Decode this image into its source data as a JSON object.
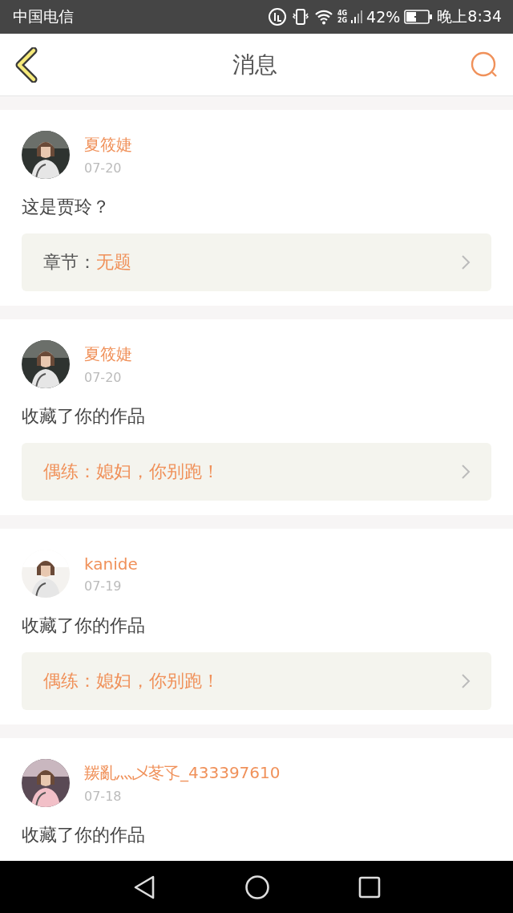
{
  "status_bar": {
    "carrier": "中国电信",
    "network": [
      "4G",
      "2G"
    ],
    "battery": "42%",
    "time": "晚上8:34"
  },
  "header": {
    "title": "消息"
  },
  "messages": [
    {
      "name": "夏筱婕",
      "date": "07-20",
      "text": "这是贾玲？",
      "ref": {
        "label": "章节：",
        "title": "无题"
      }
    },
    {
      "name": "夏筱婕",
      "date": "07-20",
      "text": "收藏了你的作品",
      "ref": {
        "title": "偶练：媳妇，你别跑！"
      }
    },
    {
      "name": "kanide",
      "date": "07-19",
      "text": "收藏了你的作品",
      "ref": {
        "title": "偶练：媳妇，你别跑！"
      }
    },
    {
      "name": "羰亂灬乄苳孓_433397610",
      "date": "07-18",
      "text": "收藏了你的作品"
    }
  ]
}
